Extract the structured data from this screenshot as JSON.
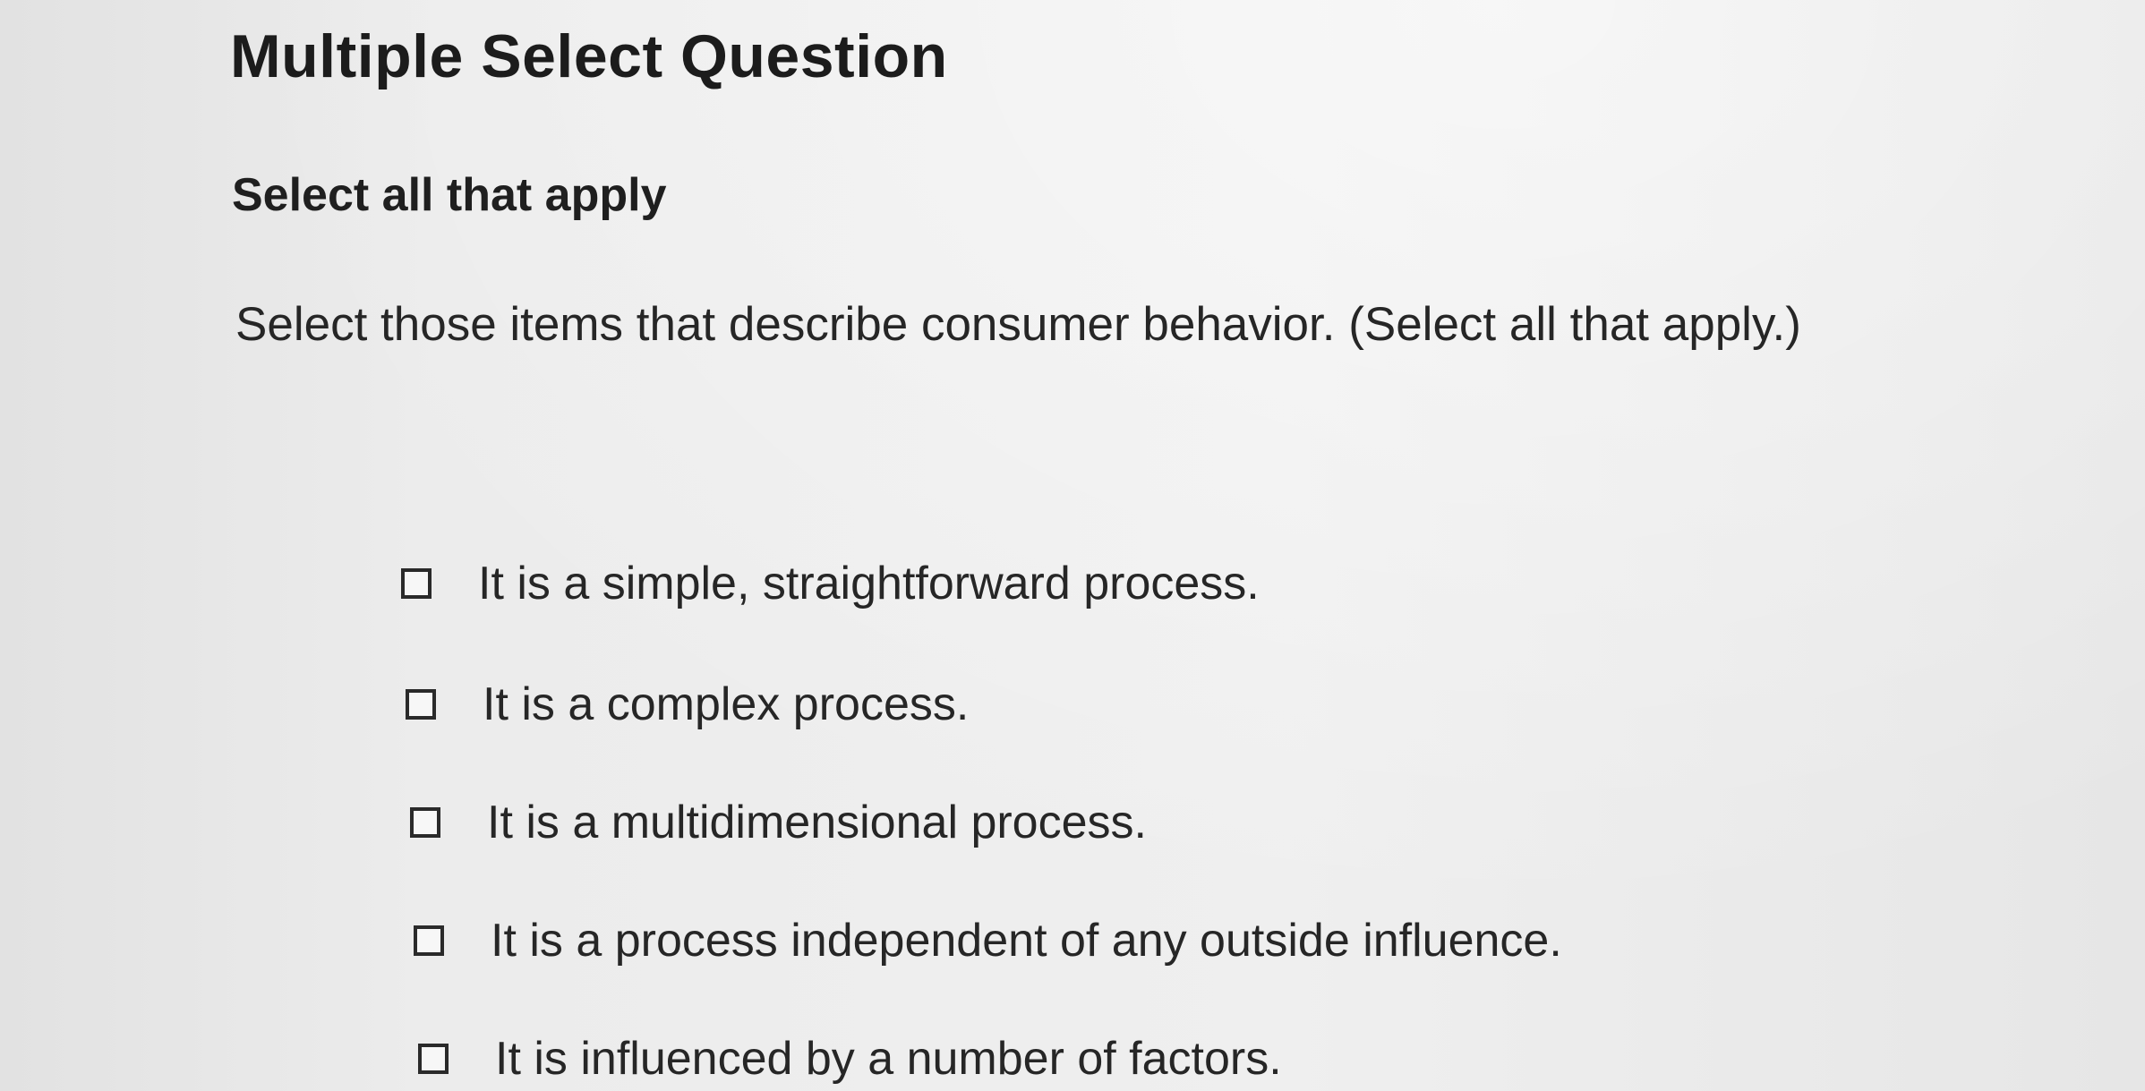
{
  "question": {
    "title": "Multiple Select Question",
    "instruction": "Select all that apply",
    "prompt": "Select those items that describe consumer behavior. (Select all that apply.)"
  },
  "options": [
    {
      "label": "It is a simple, straightforward process.",
      "checked": false
    },
    {
      "label": "It is a complex process.",
      "checked": false
    },
    {
      "label": "It is a multidimensional process.",
      "checked": false
    },
    {
      "label": "It is a process independent of any outside influence.",
      "checked": false
    },
    {
      "label": "It is influenced by a number of factors.",
      "checked": false
    }
  ]
}
